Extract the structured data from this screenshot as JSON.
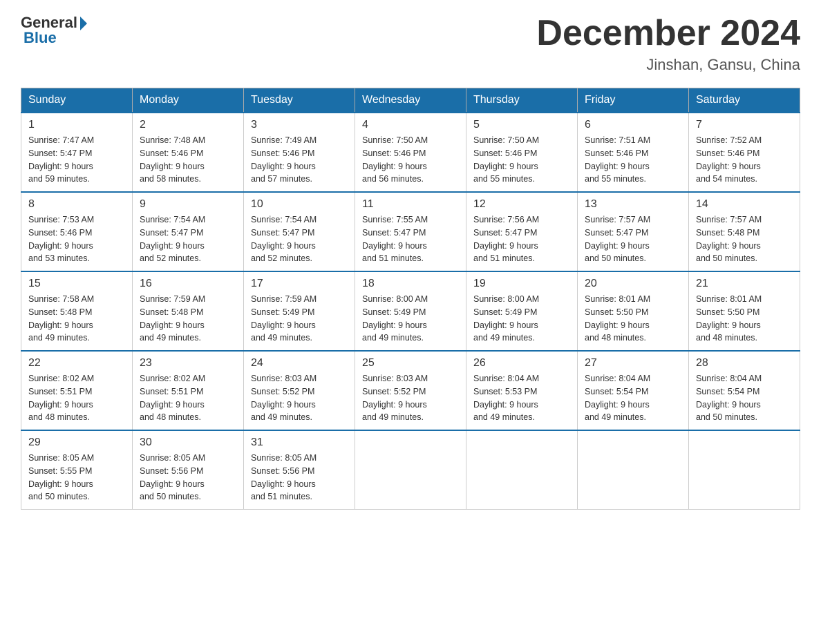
{
  "header": {
    "logo_general": "General",
    "logo_blue": "Blue",
    "month_title": "December 2024",
    "location": "Jinshan, Gansu, China"
  },
  "weekdays": [
    "Sunday",
    "Monday",
    "Tuesday",
    "Wednesday",
    "Thursday",
    "Friday",
    "Saturday"
  ],
  "weeks": [
    [
      {
        "day": "1",
        "sunrise": "7:47 AM",
        "sunset": "5:47 PM",
        "daylight": "9 hours and 59 minutes."
      },
      {
        "day": "2",
        "sunrise": "7:48 AM",
        "sunset": "5:46 PM",
        "daylight": "9 hours and 58 minutes."
      },
      {
        "day": "3",
        "sunrise": "7:49 AM",
        "sunset": "5:46 PM",
        "daylight": "9 hours and 57 minutes."
      },
      {
        "day": "4",
        "sunrise": "7:50 AM",
        "sunset": "5:46 PM",
        "daylight": "9 hours and 56 minutes."
      },
      {
        "day": "5",
        "sunrise": "7:50 AM",
        "sunset": "5:46 PM",
        "daylight": "9 hours and 55 minutes."
      },
      {
        "day": "6",
        "sunrise": "7:51 AM",
        "sunset": "5:46 PM",
        "daylight": "9 hours and 55 minutes."
      },
      {
        "day": "7",
        "sunrise": "7:52 AM",
        "sunset": "5:46 PM",
        "daylight": "9 hours and 54 minutes."
      }
    ],
    [
      {
        "day": "8",
        "sunrise": "7:53 AM",
        "sunset": "5:46 PM",
        "daylight": "9 hours and 53 minutes."
      },
      {
        "day": "9",
        "sunrise": "7:54 AM",
        "sunset": "5:47 PM",
        "daylight": "9 hours and 52 minutes."
      },
      {
        "day": "10",
        "sunrise": "7:54 AM",
        "sunset": "5:47 PM",
        "daylight": "9 hours and 52 minutes."
      },
      {
        "day": "11",
        "sunrise": "7:55 AM",
        "sunset": "5:47 PM",
        "daylight": "9 hours and 51 minutes."
      },
      {
        "day": "12",
        "sunrise": "7:56 AM",
        "sunset": "5:47 PM",
        "daylight": "9 hours and 51 minutes."
      },
      {
        "day": "13",
        "sunrise": "7:57 AM",
        "sunset": "5:47 PM",
        "daylight": "9 hours and 50 minutes."
      },
      {
        "day": "14",
        "sunrise": "7:57 AM",
        "sunset": "5:48 PM",
        "daylight": "9 hours and 50 minutes."
      }
    ],
    [
      {
        "day": "15",
        "sunrise": "7:58 AM",
        "sunset": "5:48 PM",
        "daylight": "9 hours and 49 minutes."
      },
      {
        "day": "16",
        "sunrise": "7:59 AM",
        "sunset": "5:48 PM",
        "daylight": "9 hours and 49 minutes."
      },
      {
        "day": "17",
        "sunrise": "7:59 AM",
        "sunset": "5:49 PM",
        "daylight": "9 hours and 49 minutes."
      },
      {
        "day": "18",
        "sunrise": "8:00 AM",
        "sunset": "5:49 PM",
        "daylight": "9 hours and 49 minutes."
      },
      {
        "day": "19",
        "sunrise": "8:00 AM",
        "sunset": "5:49 PM",
        "daylight": "9 hours and 49 minutes."
      },
      {
        "day": "20",
        "sunrise": "8:01 AM",
        "sunset": "5:50 PM",
        "daylight": "9 hours and 48 minutes."
      },
      {
        "day": "21",
        "sunrise": "8:01 AM",
        "sunset": "5:50 PM",
        "daylight": "9 hours and 48 minutes."
      }
    ],
    [
      {
        "day": "22",
        "sunrise": "8:02 AM",
        "sunset": "5:51 PM",
        "daylight": "9 hours and 48 minutes."
      },
      {
        "day": "23",
        "sunrise": "8:02 AM",
        "sunset": "5:51 PM",
        "daylight": "9 hours and 48 minutes."
      },
      {
        "day": "24",
        "sunrise": "8:03 AM",
        "sunset": "5:52 PM",
        "daylight": "9 hours and 49 minutes."
      },
      {
        "day": "25",
        "sunrise": "8:03 AM",
        "sunset": "5:52 PM",
        "daylight": "9 hours and 49 minutes."
      },
      {
        "day": "26",
        "sunrise": "8:04 AM",
        "sunset": "5:53 PM",
        "daylight": "9 hours and 49 minutes."
      },
      {
        "day": "27",
        "sunrise": "8:04 AM",
        "sunset": "5:54 PM",
        "daylight": "9 hours and 49 minutes."
      },
      {
        "day": "28",
        "sunrise": "8:04 AM",
        "sunset": "5:54 PM",
        "daylight": "9 hours and 50 minutes."
      }
    ],
    [
      {
        "day": "29",
        "sunrise": "8:05 AM",
        "sunset": "5:55 PM",
        "daylight": "9 hours and 50 minutes."
      },
      {
        "day": "30",
        "sunrise": "8:05 AM",
        "sunset": "5:56 PM",
        "daylight": "9 hours and 50 minutes."
      },
      {
        "day": "31",
        "sunrise": "8:05 AM",
        "sunset": "5:56 PM",
        "daylight": "9 hours and 51 minutes."
      },
      null,
      null,
      null,
      null
    ]
  ],
  "labels": {
    "sunrise_prefix": "Sunrise: ",
    "sunset_prefix": "Sunset: ",
    "daylight_prefix": "Daylight: "
  }
}
